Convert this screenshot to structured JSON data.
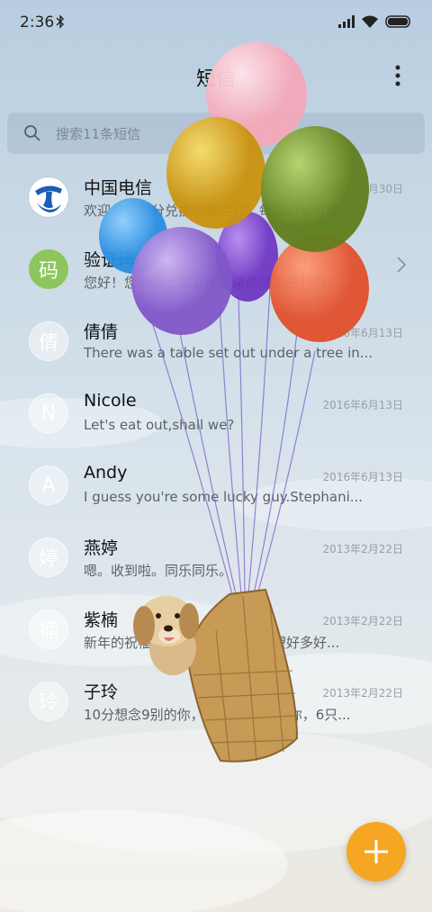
{
  "status": {
    "time": "2:36"
  },
  "app": {
    "title": "短信"
  },
  "search": {
    "placeholder": "搜索11条短信"
  },
  "conversations": [
    {
      "name": "中国电信",
      "date": "2017年6月30日",
      "preview": "欢迎参加积分兑换话费活动，每500分可兑...",
      "avatar": ""
    },
    {
      "name": "验证码",
      "date": "",
      "preview": "您好！您的网上营业厅登录的随机密码为：...",
      "avatar": "码"
    },
    {
      "name": "倩倩",
      "date": "2016年6月13日",
      "preview": "There was a table set out under a tree in...",
      "avatar": "倩"
    },
    {
      "name": "Nicole",
      "date": "2016年6月13日",
      "preview": "Let's eat out,shall we?",
      "avatar": "N"
    },
    {
      "name": "Andy",
      "date": "2016年6月13日",
      "preview": "I guess you're some lucky guy.Stephani...",
      "avatar": "A"
    },
    {
      "name": "燕婷",
      "date": "2013年2月22日",
      "preview": "嗯。收到啦。同乐同乐。",
      "avatar": "婷"
    },
    {
      "name": "紫楠",
      "date": "2013年2月22日",
      "preview": "新年的祝福数不胜数，新年的愿望好多好...",
      "avatar": "楠"
    },
    {
      "name": "子玲",
      "date": "2013年2月22日",
      "preview": "10分想念9别的你，8张照片7张是你，6只...",
      "avatar": "玲"
    }
  ],
  "icons": {
    "search": "search-icon",
    "menu": "more-vertical-icon",
    "fab": "plus-icon",
    "chevron": "chevron-right-icon",
    "bluetooth": "bluetooth-icon",
    "signal": "signal-icon",
    "wifi": "wifi-icon",
    "battery": "battery-icon"
  },
  "colors": {
    "fab": "#f5a623",
    "verification_avatar": "#8cc65c",
    "telecom_blue": "#1a5fb4"
  }
}
